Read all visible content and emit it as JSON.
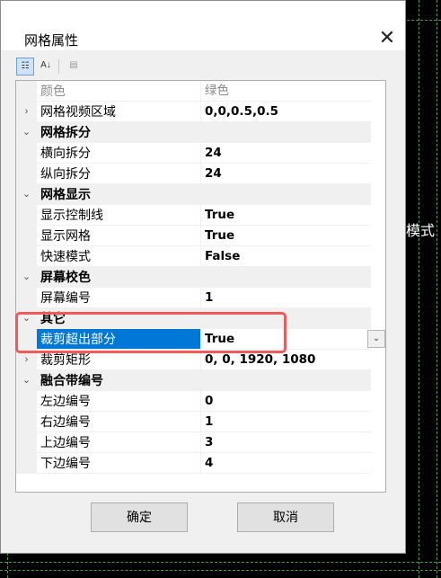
{
  "window": {
    "title": "网格属性",
    "close_glyph": "✕"
  },
  "background_text": "模式",
  "toolbar": {
    "categorized_glyph": "☷",
    "alphabetical_glyph": "A↓",
    "pages_glyph": "▤"
  },
  "rows": [
    {
      "type": "prop",
      "name": "颜色",
      "value": "绿色",
      "faded": true
    },
    {
      "type": "prop",
      "name": "网格视频区域",
      "value": "0,0,0.5,0.5",
      "expander": "›"
    },
    {
      "type": "cat",
      "name": "网格拆分",
      "expander": "⌄"
    },
    {
      "type": "prop",
      "name": "横向拆分",
      "value": "24"
    },
    {
      "type": "prop",
      "name": "纵向拆分",
      "value": "24"
    },
    {
      "type": "cat",
      "name": "网格显示",
      "expander": "⌄"
    },
    {
      "type": "prop",
      "name": "显示控制线",
      "value": "True"
    },
    {
      "type": "prop",
      "name": "显示网格",
      "value": "True"
    },
    {
      "type": "prop",
      "name": "快速模式",
      "value": "False"
    },
    {
      "type": "cat",
      "name": "屏幕校色",
      "expander": "⌄"
    },
    {
      "type": "prop",
      "name": "屏幕编号",
      "value": "1"
    },
    {
      "type": "cat",
      "name": "其它",
      "expander": "⌄"
    },
    {
      "type": "prop",
      "name": "裁剪超出部分",
      "value": "True",
      "selected": true,
      "dropdown": "⌄"
    },
    {
      "type": "prop",
      "name": "裁剪矩形",
      "value": "0, 0, 1920, 1080",
      "expander": "›"
    },
    {
      "type": "cat",
      "name": "融合带编号",
      "expander": "⌄"
    },
    {
      "type": "prop",
      "name": "左边编号",
      "value": "0"
    },
    {
      "type": "prop",
      "name": "右边编号",
      "value": "1"
    },
    {
      "type": "prop",
      "name": "上边编号",
      "value": "3"
    },
    {
      "type": "prop",
      "name": "下边编号",
      "value": "4"
    }
  ],
  "scrollbar": {
    "up_glyph": "▲",
    "down_glyph": "▼"
  },
  "buttons": {
    "ok": "确定",
    "cancel": "取消"
  },
  "colors": {
    "selection": "#0078d7",
    "highlight_box": "#f05a5a",
    "grid_lines": "#4a9a4a"
  }
}
